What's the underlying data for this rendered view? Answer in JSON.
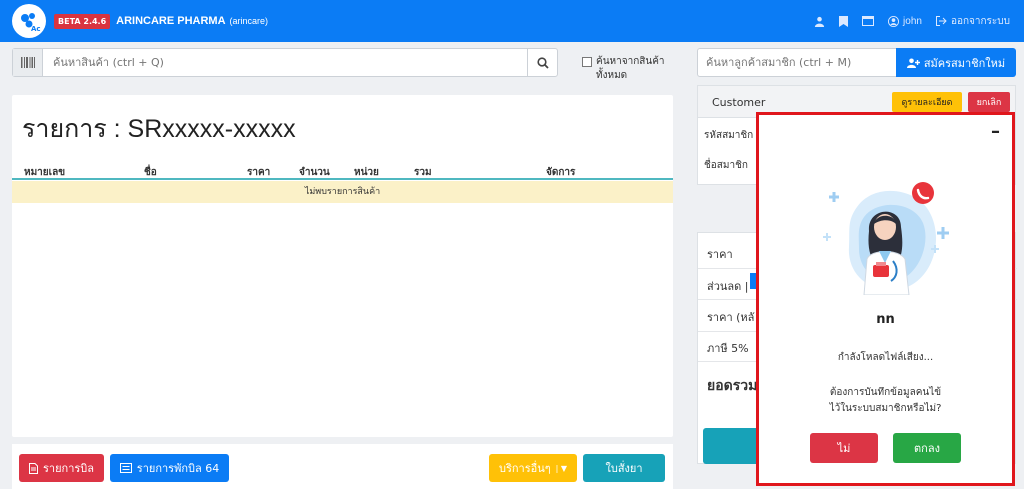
{
  "app": {
    "badge": "BETA 2.4.6",
    "brand": "ARINCARE PHARMA",
    "brand_sub": "(arincare)"
  },
  "nav": {
    "user": "john",
    "logout": "ออกจากระบบ"
  },
  "search": {
    "placeholder": "ค้นหาสินค้า (ctrl + Q)",
    "all_label_line1": "ค้นหาจากสินค้า",
    "all_label_line2": "ทั้งหมด"
  },
  "main": {
    "title": "รายการ : SRxxxxx-xxxxx",
    "columns": [
      "หมายเลข",
      "ชื่อ",
      "ราคา",
      "จำนวน",
      "หน่วย",
      "รวม",
      "จัดการ"
    ],
    "empty_text": "ไม่พบรายการสินค้า"
  },
  "bottom": {
    "bill_list": "รายการบิล",
    "held_bills": "รายการพักบิล 64",
    "other_services": "บริการอื่นๆ",
    "prescription": "ใบสั่งยา"
  },
  "member": {
    "search_placeholder": "ค้นหาลูกค้าสมาชิก (ctrl + M)",
    "register": "สมัครสมาชิกใหม่",
    "customer_label": "Customer",
    "detail_button": "ดูรายละเอียด",
    "cancel_button": "ยกเลิก",
    "member_code_label": "รหัสสมาชิก",
    "member_name_label": "ชื่อสมาชิก"
  },
  "price": {
    "price_label": "ราคา",
    "discount_label": "ส่วนลด |",
    "after_label": "ราคา (หลั",
    "vat_label": "ภาษี 5%",
    "total_label": "ยอดรวม"
  },
  "popup": {
    "name": "nn",
    "status": "กำลังโหลดไฟล์เสียง...",
    "question_line1": "ต้องการบันทึกข้อมูลคนไข้",
    "question_line2": "ไว้ในระบบสมาชิกหรือไม่?",
    "no": "ไม่",
    "ok": "ตกลง"
  },
  "colors": {
    "primary": "#0b7cf5",
    "danger": "#dc3545",
    "success": "#28a745",
    "warning": "#ffc107",
    "info": "#17a2b8",
    "highlight_border": "#e0161c"
  }
}
